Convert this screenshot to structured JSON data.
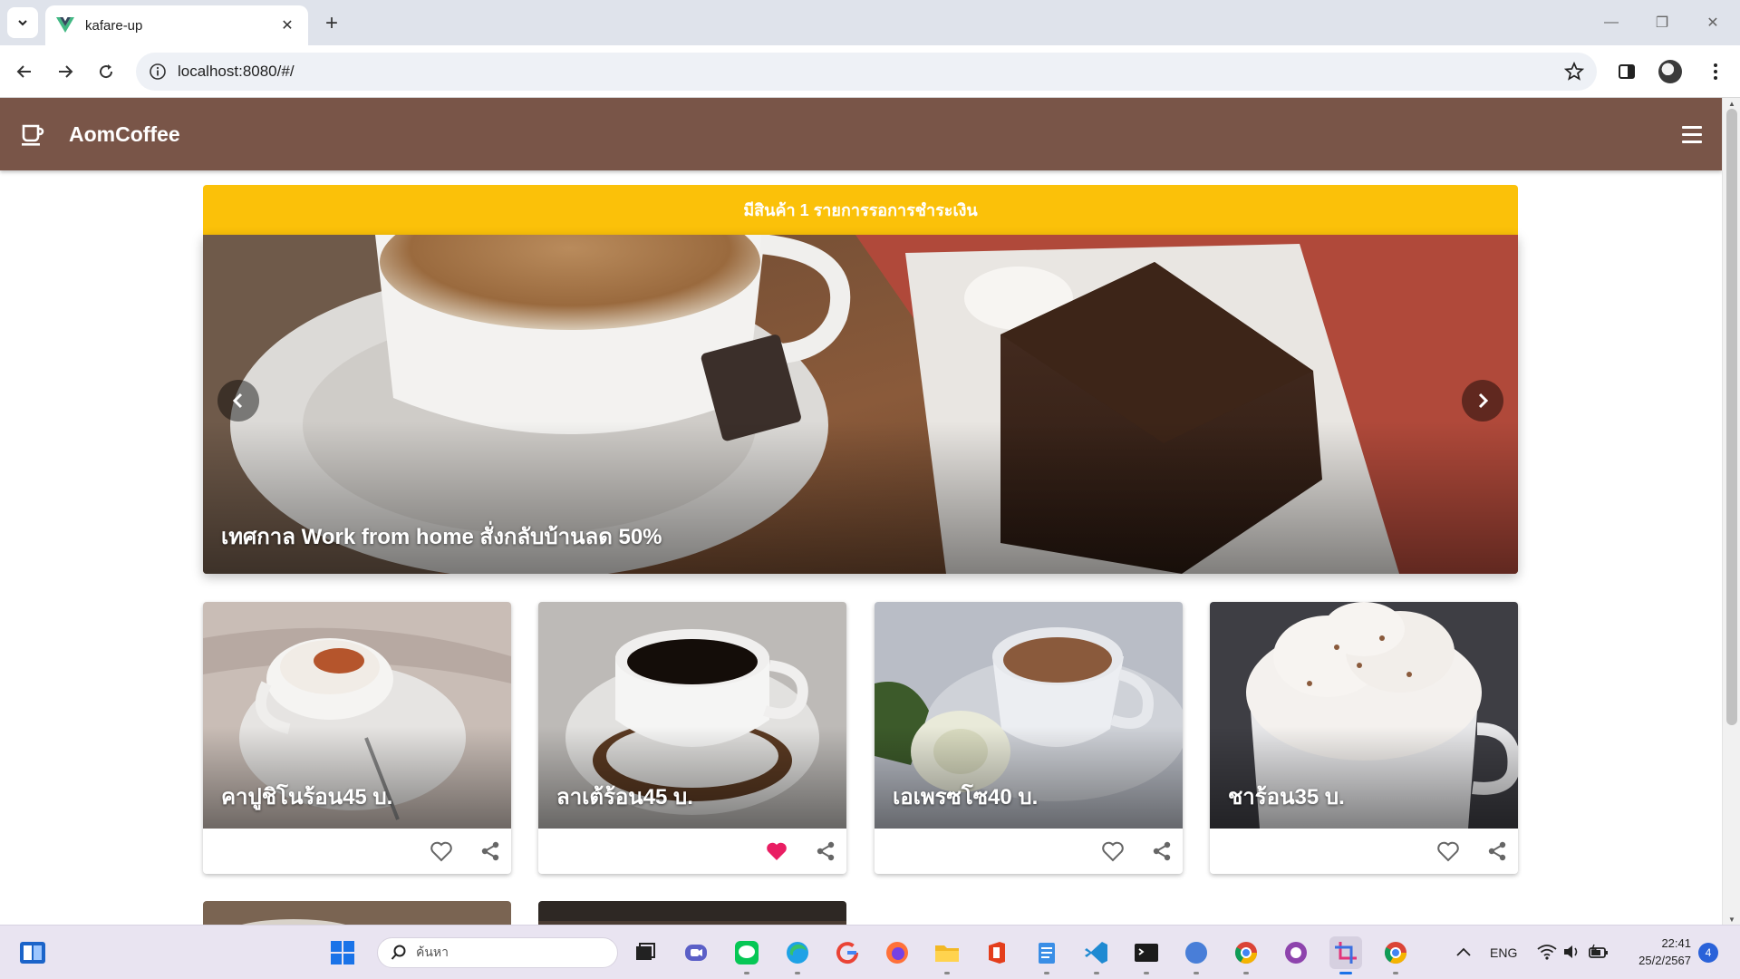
{
  "browser": {
    "tab_title": "kafare-up",
    "url": "localhost:8080/#/"
  },
  "app": {
    "title": "AomCoffee",
    "brand_color": "#795548",
    "alert_color": "#fbc109",
    "alert_text": "มีสินค้า 1 รายการรอการชำระเงิน"
  },
  "carousel": {
    "caption": "เทศกาล Work from home สั่งกลับบ้านลด 50%"
  },
  "products": [
    {
      "title": "คาปูชิโนร้อน45 บ.",
      "favorited": false
    },
    {
      "title": "ลาเต้ร้อน45 บ.",
      "favorited": true
    },
    {
      "title": "เอเพรซโซ40 บ.",
      "favorited": false
    },
    {
      "title": "ชาร้อน35 บ.",
      "favorited": false
    }
  ],
  "taskbar": {
    "search_placeholder": "ค้นหา",
    "language": "ENG",
    "time": "22:41",
    "date": "25/2/2567",
    "notification_count": "4"
  }
}
